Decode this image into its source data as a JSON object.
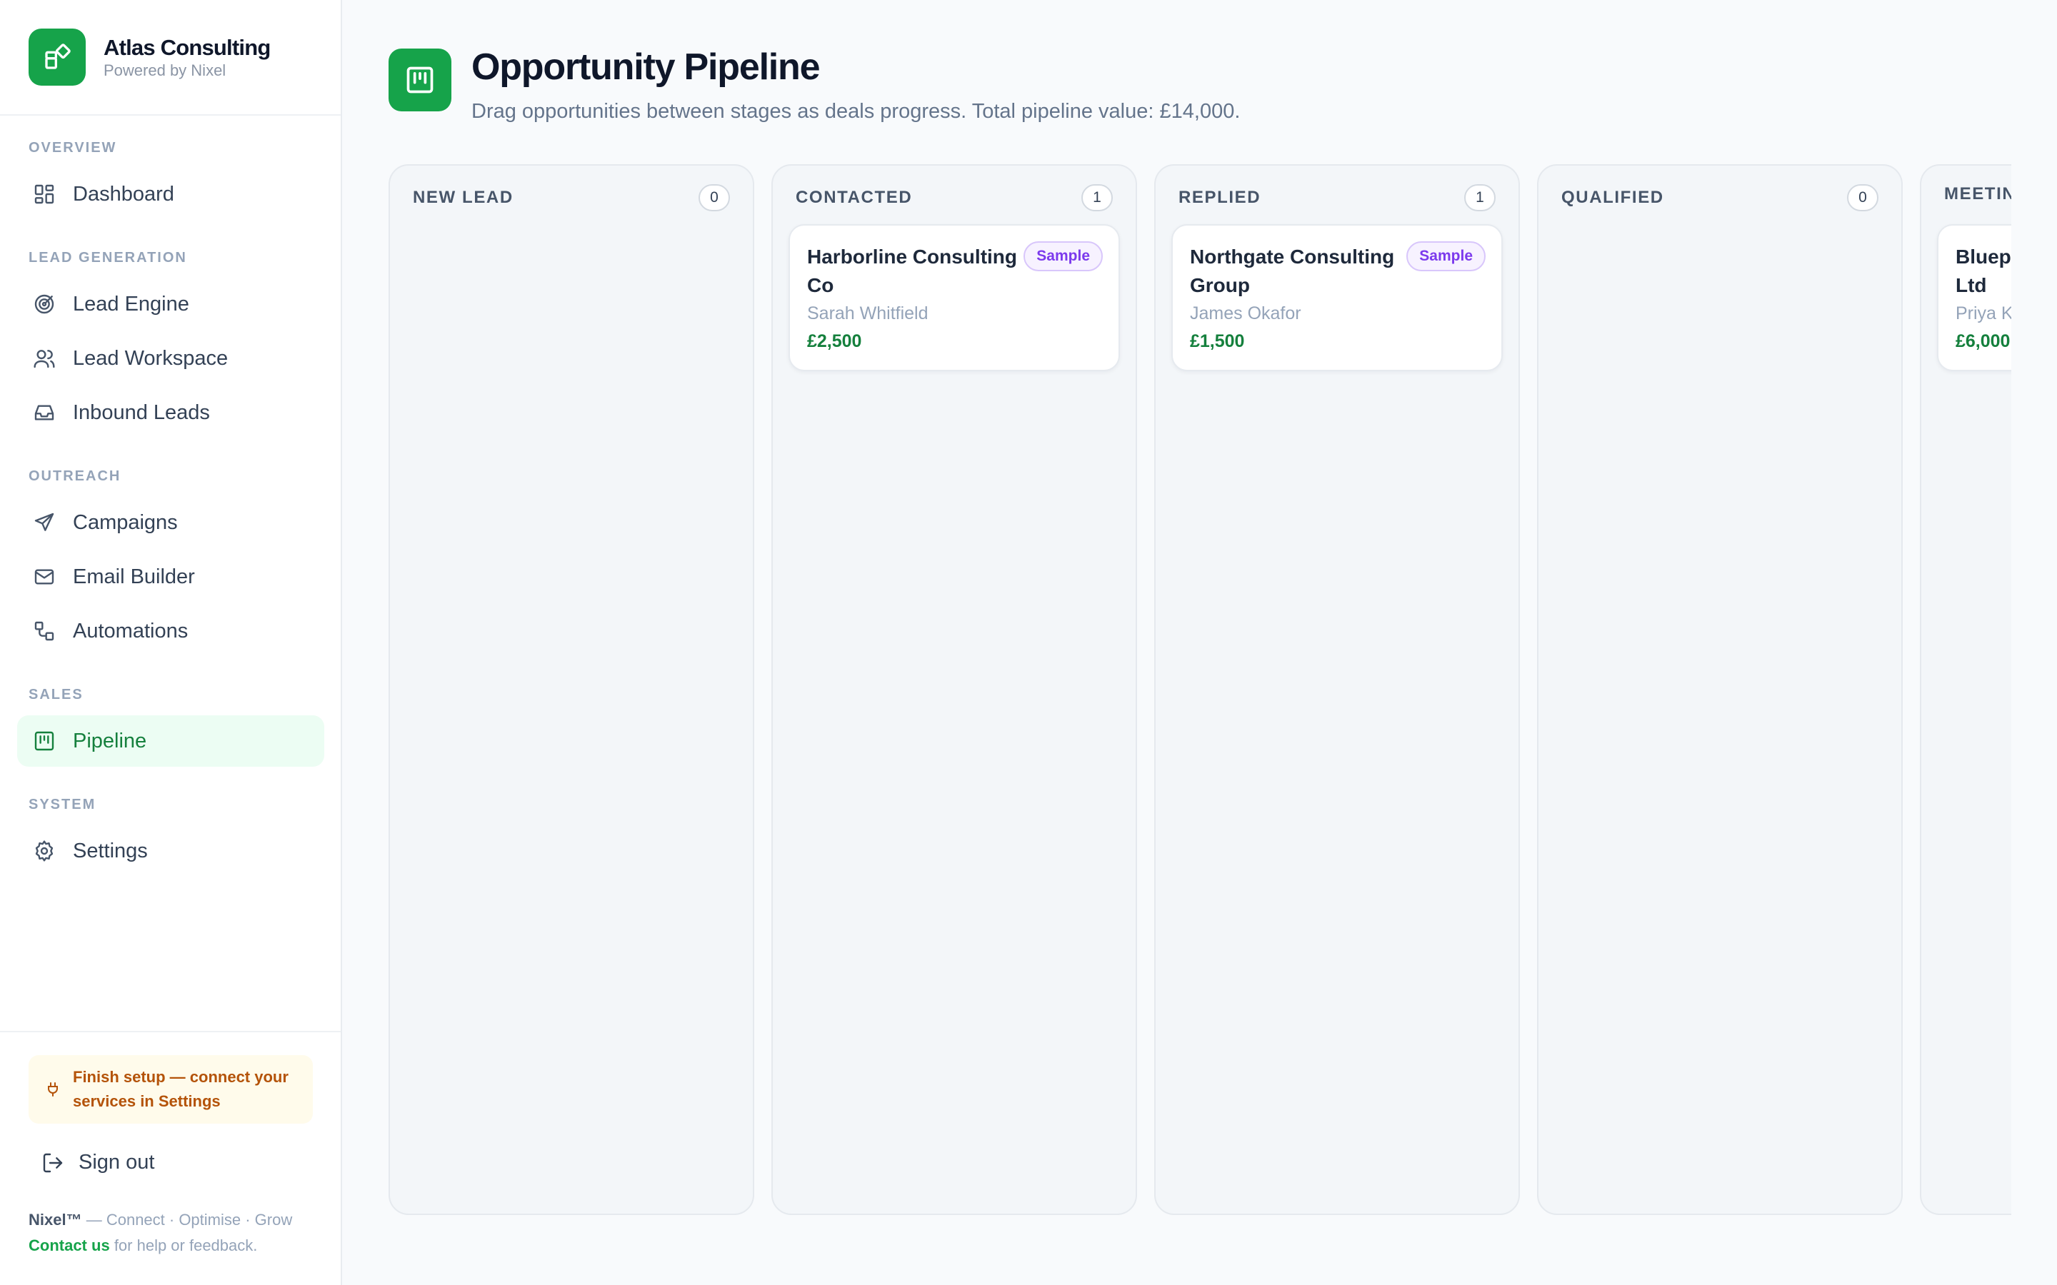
{
  "brand": {
    "name": "Atlas Consulting",
    "sub": "Powered by Nixel"
  },
  "nav": {
    "sections": {
      "overview": "OVERVIEW",
      "lead_generation": "LEAD GENERATION",
      "outreach": "OUTREACH",
      "sales": "SALES",
      "system": "SYSTEM"
    },
    "items": {
      "dashboard": "Dashboard",
      "lead_engine": "Lead Engine",
      "lead_workspace": "Lead Workspace",
      "inbound_leads": "Inbound Leads",
      "campaigns": "Campaigns",
      "email_builder": "Email Builder",
      "automations": "Automations",
      "pipeline": "Pipeline",
      "settings": "Settings"
    },
    "active": "pipeline"
  },
  "sidebar_footer": {
    "setup_notice": "Finish setup — connect your services in Settings",
    "sign_out": "Sign out",
    "brand_mark": "Nixel™",
    "tagline": "— Connect · Optimise · Grow",
    "contact_link": "Contact us",
    "contact_text": "for help or feedback."
  },
  "header": {
    "title": "Opportunity Pipeline",
    "subtitle": "Drag opportunities between stages as deals progress. Total pipeline value: £14,000."
  },
  "columns": [
    {
      "title": "NEW LEAD",
      "count": "0"
    },
    {
      "title": "CONTACTED",
      "count": "1",
      "card": {
        "company": "Harborline Consulting Co",
        "badge": "Sample",
        "contact": "Sarah Whitfield",
        "value": "£2,500"
      }
    },
    {
      "title": "REPLIED",
      "count": "1",
      "card": {
        "company": "Northgate Consulting Group",
        "badge": "Sample",
        "contact": "James Okafor",
        "value": "£1,500"
      }
    },
    {
      "title": "QUALIFIED",
      "count": "0"
    },
    {
      "title": "MEETIN",
      "card": {
        "company": "Bluep\nLtd",
        "contact": "Priya K",
        "value": "£6,000"
      }
    }
  ],
  "colors": {
    "accent": "#16a34a",
    "accent_text": "#15803d",
    "badge": "#7c3aed",
    "warning": "#b45309"
  }
}
